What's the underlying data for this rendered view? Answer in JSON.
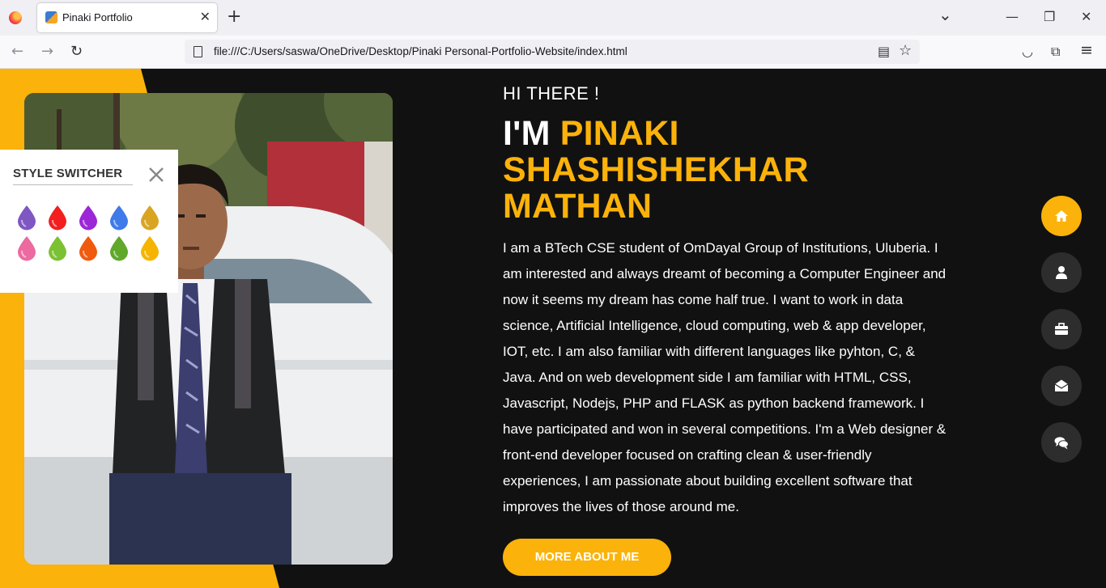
{
  "browser": {
    "tab_title": "Pinaki Portfolio",
    "tab_close": "✕",
    "new_tab": "+",
    "url": "file:///C:/Users/saswa/OneDrive/Desktop/Pinaki Personal-Portfolio-Website/index.html",
    "window_controls": {
      "list": "⌄",
      "minimize": "—",
      "restore": "❐",
      "close": "✕"
    },
    "nav": {
      "back": "←",
      "forward": "→",
      "reload": "↻"
    },
    "url_icons": {
      "reader": "▤",
      "bookmark": "☆"
    },
    "toolbar_icons": {
      "pocket": "◡",
      "extensions": "⧉",
      "menu": "≡"
    }
  },
  "hero": {
    "greeting": "HI THERE !",
    "prefix": "I'M ",
    "name": "PINAKI SHASHISHEKHAR MATHAN",
    "bio": "I am a BTech CSE student of OmDayal Group of Institutions, Uluberia. I am interested and always dreamt of becoming a Computer Engineer and now it seems my dream has come half true. I want to work in data science, Artificial Intelligence, cloud computing, web & app developer, IOT, etc. I am also familiar with different languages like pyhton, C, & Java. And on web development side I am familiar with HTML, CSS, Javascript, Nodejs, PHP and FLASK as python backend framework. I have participated and won in several competitions. I'm a Web designer & front-end developer focused on crafting clean & user-friendly experiences, I am passionate about building excellent software that improves the lives of those around me.",
    "button": "MORE ABOUT ME"
  },
  "switcher": {
    "title": "STYLE SWITCHER",
    "colors": [
      "#7e57c2",
      "#f31f1f",
      "#9c27d6",
      "#3f7be8",
      "#d9a520",
      "#ec6aa0",
      "#7cc133",
      "#f05a0f",
      "#5fa82a",
      "#f5b400"
    ]
  },
  "side_nav": [
    "home-icon",
    "user-icon",
    "briefcase-icon",
    "envelope-open-icon",
    "comments-icon"
  ],
  "theme": {
    "accent": "#fbb20a",
    "background": "#111111",
    "nav_dark": "#2d2d2d"
  }
}
